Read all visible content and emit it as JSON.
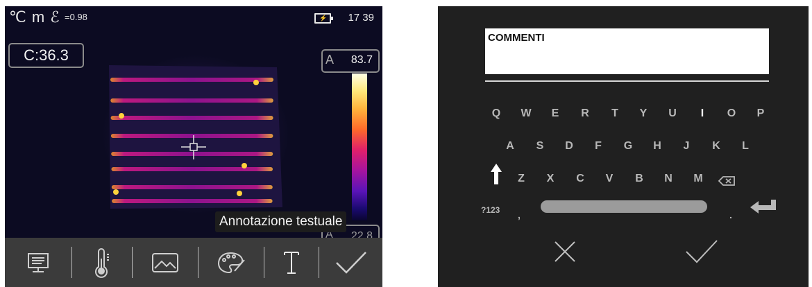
{
  "left_screen": {
    "status": {
      "unit_text": "℃ m ℰ",
      "emissivity": "=0.98",
      "time": "17 39",
      "battery_icon": "battery-charging-icon"
    },
    "center_temp": "C:36.3",
    "max_temp": {
      "flag": "A",
      "value": "83.7"
    },
    "min_temp": {
      "flag": "A",
      "value": "22.8"
    },
    "tooltip": "Annotazione testuale",
    "toolbar": {
      "buttons": [
        {
          "name": "report-icon"
        },
        {
          "name": "thermometer-icon"
        },
        {
          "name": "image-icon"
        },
        {
          "name": "palette-icon"
        },
        {
          "name": "text-annotation-icon"
        },
        {
          "name": "confirm-check-icon"
        }
      ]
    }
  },
  "right_screen": {
    "comment_label": "COMMENTI",
    "keyboard": {
      "row1": [
        "Q",
        "W",
        "E",
        "R",
        "T",
        "Y",
        "U",
        "I",
        "O",
        "P"
      ],
      "row2": [
        "A",
        "S",
        "D",
        "F",
        "G",
        "H",
        "J",
        "K",
        "L"
      ],
      "row3": [
        "Z",
        "X",
        "C",
        "V",
        "B",
        "N",
        "M"
      ],
      "numbers_key": "?123",
      "comma": ",",
      "period": ".",
      "shift_icon": "shift-up-arrow-icon",
      "backspace_icon": "backspace-icon",
      "enter_icon": "enter-icon"
    },
    "cancel_icon": "cancel-x-icon",
    "confirm_icon": "confirm-check-icon"
  },
  "colors": {
    "accent_hot": "#ffb43c",
    "screen_bg": "#202020",
    "toolbar_bg": "#3b3b3b"
  }
}
